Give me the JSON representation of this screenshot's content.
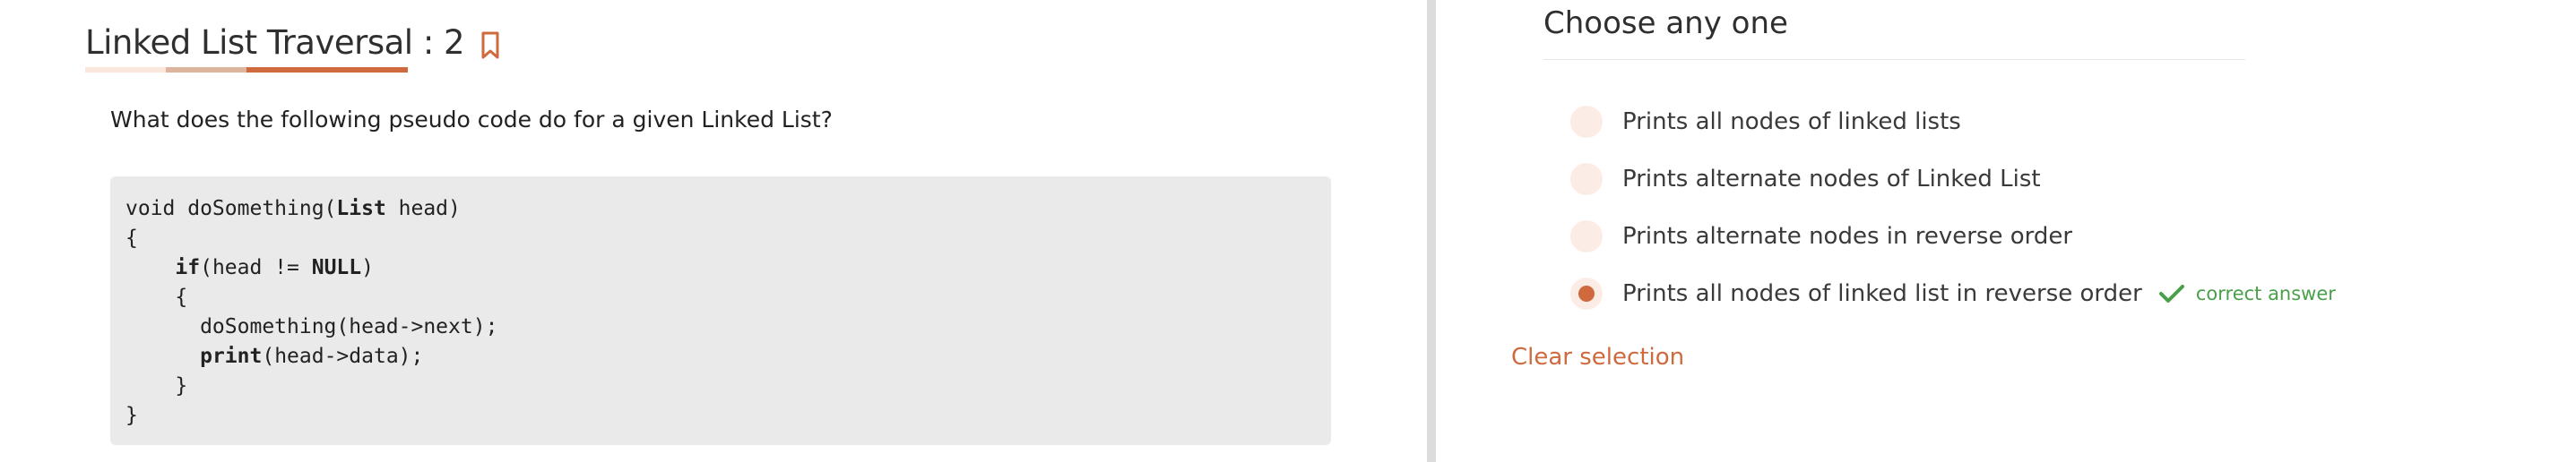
{
  "question": {
    "title": "Linked List Traversal : 2",
    "prompt": "What does the following pseudo code do for a given Linked List?",
    "progress_segments": [
      {
        "fraction": 0.25,
        "color": "#fbe6dc"
      },
      {
        "fraction": 0.25,
        "color": "#ddb59d"
      },
      {
        "fraction": 0.5,
        "color": "#cf6a3f"
      }
    ],
    "code": {
      "l1_pre": "void doSomething(",
      "l1_kw": "List",
      "l1_post": " head)",
      "l2": "{",
      "l3_pre": "    ",
      "l3_kw": "if",
      "l3_mid": "(head != ",
      "l3_kw2": "NULL",
      "l3_post": ")",
      "l4": "    {",
      "l5": "      doSomething(head->next);",
      "l6_pre": "      ",
      "l6_kw": "print",
      "l6_post": "(head->data);",
      "l7": "    }",
      "l8": "}"
    }
  },
  "answers": {
    "heading": "Choose any one",
    "options": [
      {
        "label": "Prints all nodes of linked lists",
        "selected": false
      },
      {
        "label": "Prints alternate nodes of Linked List",
        "selected": false
      },
      {
        "label": "Prints alternate nodes in reverse order",
        "selected": false
      },
      {
        "label": "Prints all nodes of linked list in reverse order",
        "selected": true
      }
    ],
    "correct_label": "correct answer",
    "clear_label": "Clear selection"
  },
  "colors": {
    "accent": "#cf6a3f",
    "correct": "#4aa04a",
    "radio_bg": "#fbece5",
    "code_bg": "#eaeaea"
  },
  "icons": {
    "bookmark": "bookmark-icon",
    "check": "check-icon"
  }
}
